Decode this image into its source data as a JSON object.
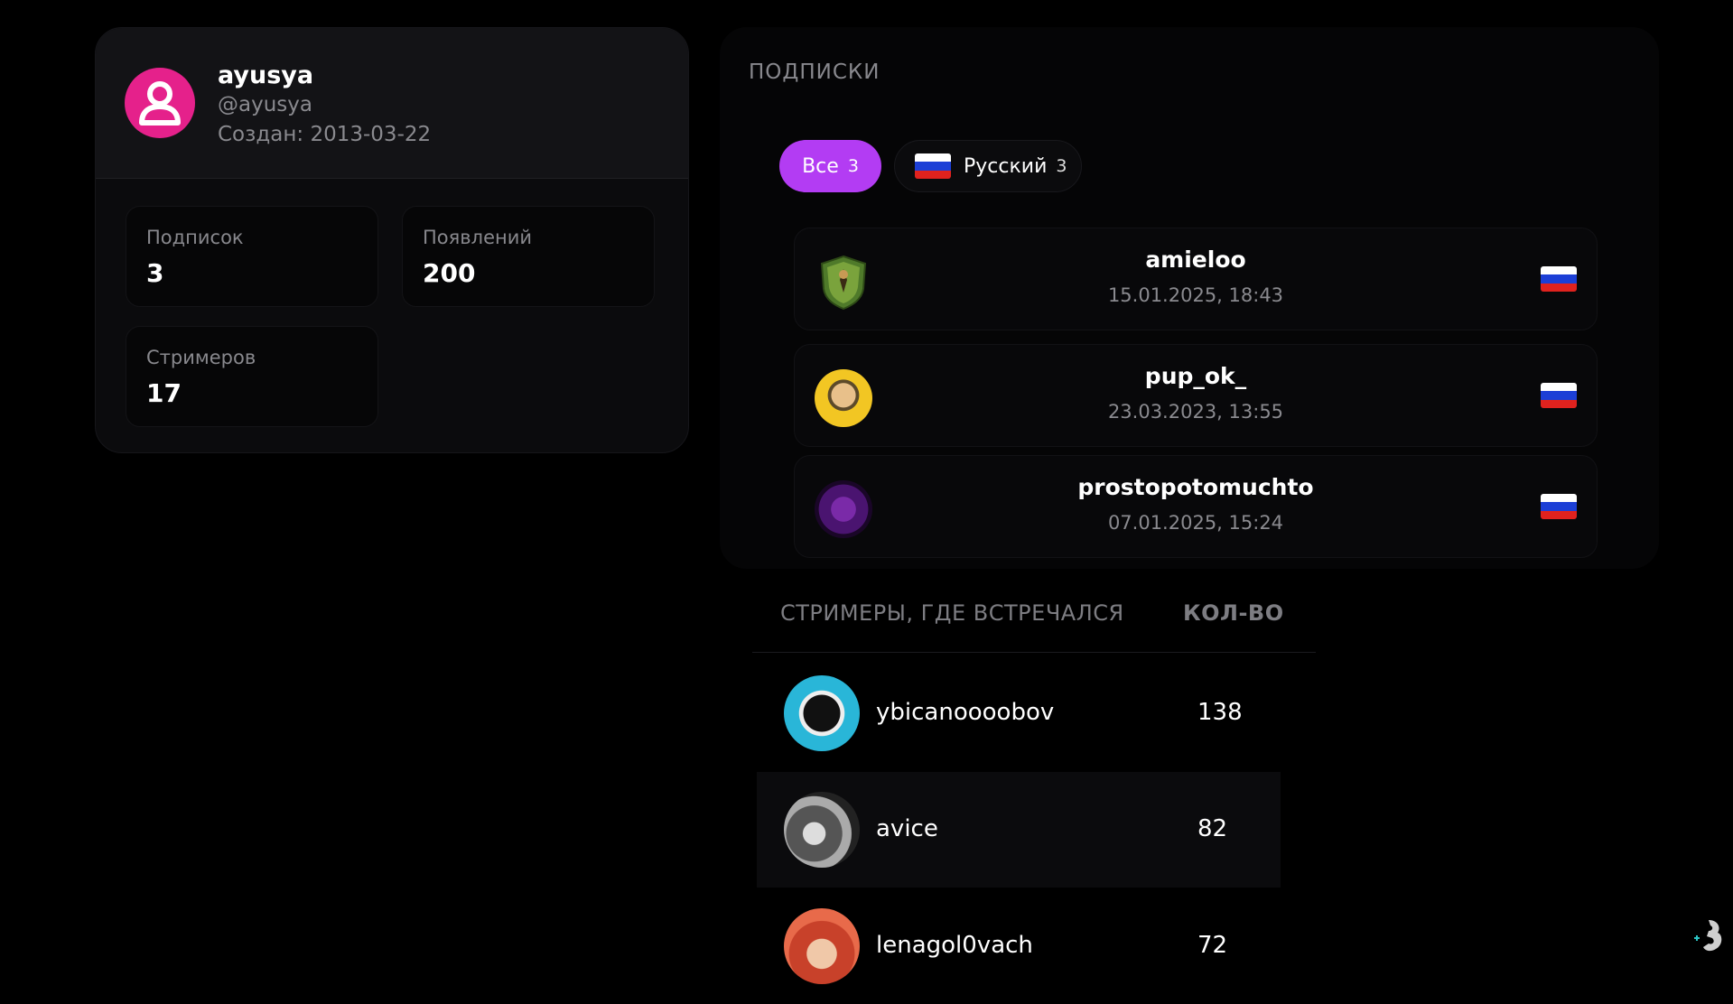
{
  "profile": {
    "username": "ayusya",
    "handle": "@ayusya",
    "created_label": "Создан:",
    "created_date": "2013-03-22",
    "avatar_color": "#e5218b",
    "stats": [
      {
        "label": "Подписок",
        "value": "3"
      },
      {
        "label": "Появлений",
        "value": "200"
      },
      {
        "label": "Стримеров",
        "value": "17"
      }
    ]
  },
  "subscriptions": {
    "title": "ПОДПИСКИ",
    "filters": [
      {
        "label": "Все",
        "count": "3",
        "active": true,
        "color": "#b33cf3"
      },
      {
        "label": "Русский",
        "count": "3",
        "active": false,
        "icon": "russia-flag-icon"
      }
    ],
    "items": [
      {
        "name": "amieloo",
        "date": "15.01.2025, 18:43",
        "flag": "russia-flag-icon"
      },
      {
        "name": "pup_ok_",
        "date": "23.03.2023, 13:55",
        "flag": "russia-flag-icon"
      },
      {
        "name": "prostopotomuchto",
        "date": "07.01.2025, 15:24",
        "flag": "russia-flag-icon"
      }
    ]
  },
  "streamers": {
    "header_name": "СТРИМЕРЫ, ГДЕ ВСТРЕЧАЛСЯ",
    "header_count": "КОЛ-ВО",
    "rows": [
      {
        "name": "ybicanoooobov",
        "count": "138"
      },
      {
        "name": "avice",
        "count": "82"
      },
      {
        "name": "lenagol0vach",
        "count": "72"
      }
    ]
  }
}
